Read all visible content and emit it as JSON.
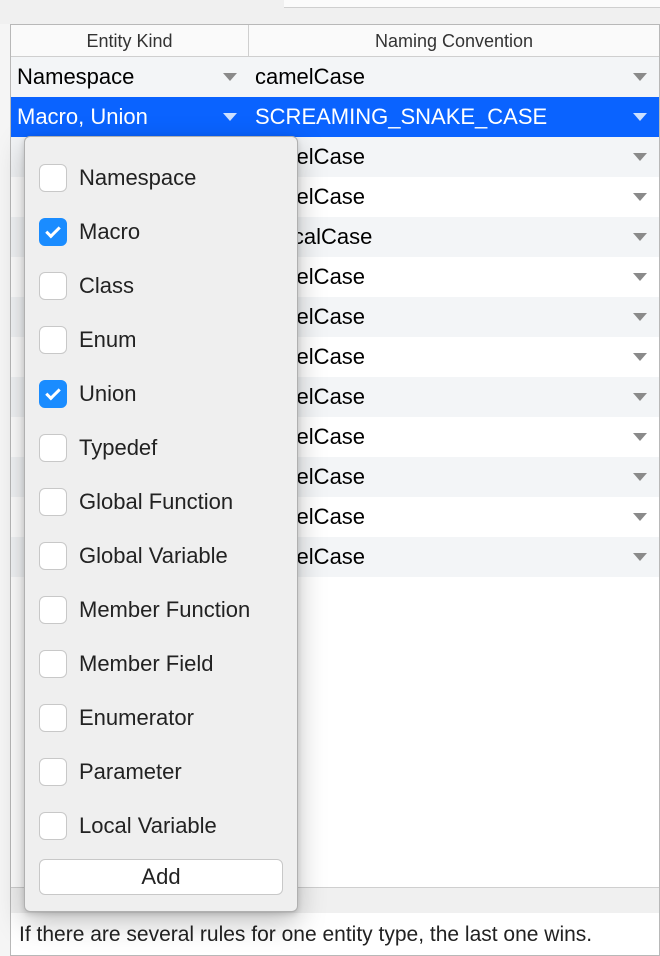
{
  "headers": {
    "entity": "Entity Kind",
    "convention": "Naming Convention"
  },
  "rows": [
    {
      "entity": "Namespace",
      "convention": "camelCase"
    },
    {
      "entity": "Macro, Union",
      "convention": "SCREAMING_SNAKE_CASE"
    },
    {
      "entity": "",
      "convention": "camelCase"
    },
    {
      "entity": "",
      "convention": "camelCase"
    },
    {
      "entity": "",
      "convention": "PascalCase"
    },
    {
      "entity": "",
      "convention": "camelCase"
    },
    {
      "entity": "",
      "convention": "camelCase"
    },
    {
      "entity": "",
      "convention": "camelCase"
    },
    {
      "entity": "",
      "convention": "camelCase"
    },
    {
      "entity": "",
      "convention": "camelCase"
    },
    {
      "entity": "",
      "convention": "camelCase"
    },
    {
      "entity": "",
      "convention": "camelCase"
    },
    {
      "entity": "",
      "convention": "camelCase"
    }
  ],
  "selected_row_index": 1,
  "popup": {
    "items": [
      {
        "label": "Namespace",
        "checked": false
      },
      {
        "label": "Macro",
        "checked": true
      },
      {
        "label": "Class",
        "checked": false
      },
      {
        "label": "Enum",
        "checked": false
      },
      {
        "label": "Union",
        "checked": true
      },
      {
        "label": "Typedef",
        "checked": false
      },
      {
        "label": "Global Function",
        "checked": false
      },
      {
        "label": "Global Variable",
        "checked": false
      },
      {
        "label": "Member Function",
        "checked": false
      },
      {
        "label": "Member Field",
        "checked": false
      },
      {
        "label": "Enumerator",
        "checked": false
      },
      {
        "label": "Parameter",
        "checked": false
      },
      {
        "label": "Local Variable",
        "checked": false
      }
    ],
    "add_label": "Add"
  },
  "footer": "If there are several rules for one entity type, the last one wins."
}
